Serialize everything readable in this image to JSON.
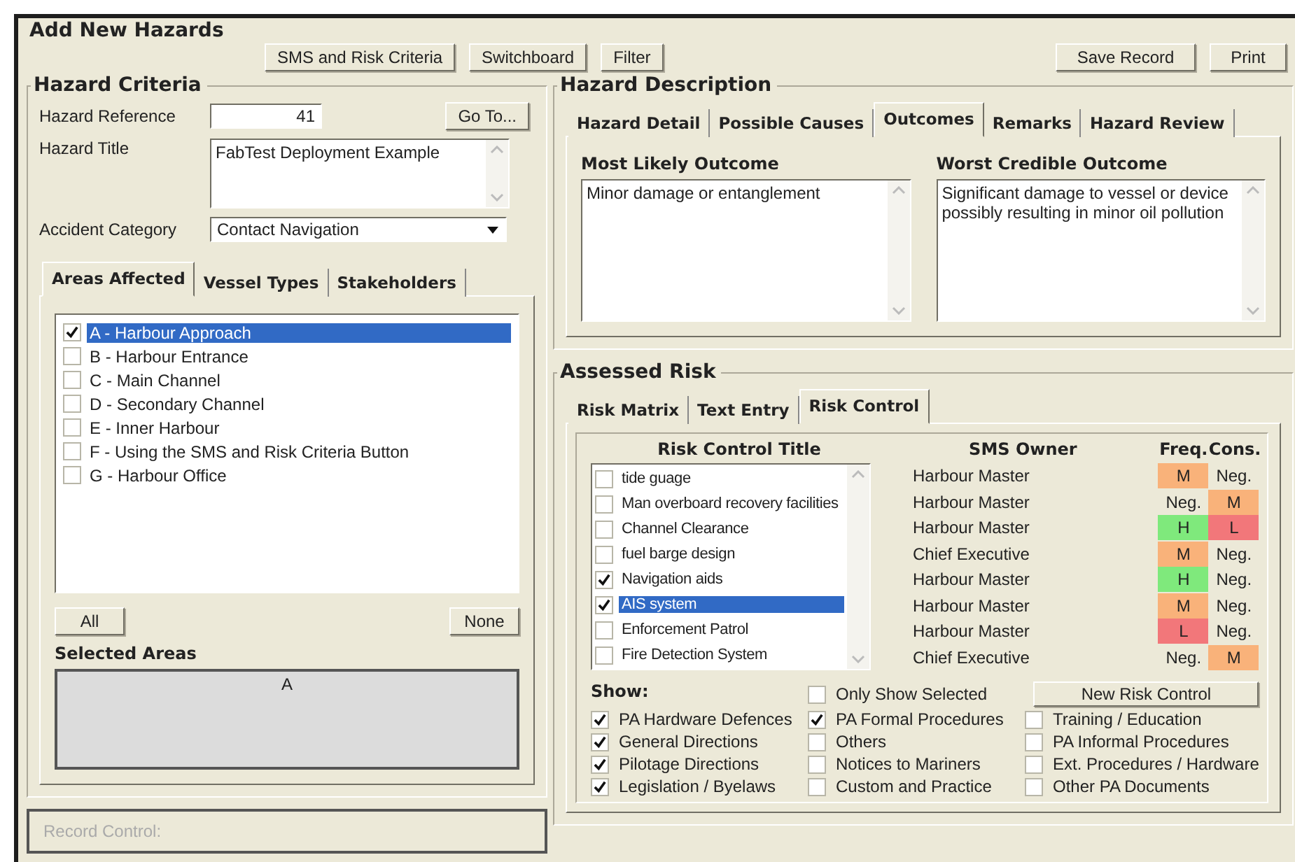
{
  "window": {
    "title": "Add New Hazards"
  },
  "toolbar": {
    "left_buttons": [
      "SMS and Risk Criteria",
      "Switchboard",
      "Filter"
    ],
    "right_buttons": [
      "Save Record",
      "Print"
    ]
  },
  "hazard_criteria": {
    "title": "Hazard Criteria",
    "reference": {
      "label": "Hazard Reference",
      "value": "41",
      "button": "Go To..."
    },
    "hazard_title": {
      "label": "Hazard Title",
      "value": "FabTest Deployment Example"
    },
    "category": {
      "label": "Accident Category",
      "value": "Contact Navigation"
    },
    "tabs": [
      {
        "label": "Areas Affected",
        "selected": true
      },
      {
        "label": "Vessel Types",
        "selected": false
      },
      {
        "label": "Stakeholders",
        "selected": false
      }
    ],
    "areas": [
      {
        "label": "A - Harbour Approach",
        "checked": true,
        "selected": true
      },
      {
        "label": "B - Harbour Entrance",
        "checked": false,
        "selected": false
      },
      {
        "label": "C - Main Channel",
        "checked": false,
        "selected": false
      },
      {
        "label": "D - Secondary Channel",
        "checked": false,
        "selected": false
      },
      {
        "label": "E - Inner Harbour",
        "checked": false,
        "selected": false
      },
      {
        "label": "F - Using the SMS and Risk Criteria Button",
        "checked": false,
        "selected": false
      },
      {
        "label": "G - Harbour Office",
        "checked": false,
        "selected": false
      }
    ],
    "buttons": [
      "All",
      "None"
    ],
    "selected_areas": {
      "label": "Selected Areas",
      "value": "A"
    }
  },
  "record_control": {
    "label": "Record Control:"
  },
  "hazard_description": {
    "title": "Hazard Description",
    "tabs": [
      {
        "label": "Hazard Detail",
        "selected": false
      },
      {
        "label": "Possible Causes",
        "selected": false
      },
      {
        "label": "Outcomes",
        "selected": true
      },
      {
        "label": "Remarks",
        "selected": false
      },
      {
        "label": "Hazard Review",
        "selected": false
      }
    ],
    "outcomes": [
      {
        "label": "Most Likely Outcome",
        "text": "Minor damage or entanglement"
      },
      {
        "label": "Worst Credible Outcome",
        "text": "Significant damage to vessel or device possibly resulting in minor oil pollution"
      }
    ]
  },
  "assessed_risk": {
    "title": "Assessed Risk",
    "tabs": [
      {
        "label": "Risk Matrix",
        "selected": false
      },
      {
        "label": "Text Entry",
        "selected": false
      },
      {
        "label": "Risk Control",
        "selected": true
      }
    ],
    "columns": [
      "Risk Control Title",
      "SMS Owner",
      "Freq.",
      "Cons."
    ],
    "controls": [
      {
        "title": "tide guage",
        "checked": false,
        "selected": false,
        "owner": "Harbour Master",
        "freq": {
          "text": "M",
          "color": "#f9b27a"
        },
        "cons": {
          "text": "Neg."
        }
      },
      {
        "title": "Man overboard recovery facilities",
        "checked": false,
        "selected": false,
        "owner": "Harbour Master",
        "freq": {
          "text": "Neg."
        },
        "cons": {
          "text": "M",
          "color": "#f9b27a"
        }
      },
      {
        "title": "Channel Clearance",
        "checked": false,
        "selected": false,
        "owner": "Harbour Master",
        "freq": {
          "text": "H",
          "color": "#7fe97c"
        },
        "cons": {
          "text": "L",
          "color": "#f2777a"
        }
      },
      {
        "title": "fuel barge design",
        "checked": false,
        "selected": false,
        "owner": "Chief Executive",
        "freq": {
          "text": "M",
          "color": "#f9b27a"
        },
        "cons": {
          "text": "Neg."
        }
      },
      {
        "title": "Navigation aids",
        "checked": true,
        "selected": false,
        "owner": "Harbour Master",
        "freq": {
          "text": "H",
          "color": "#7fe97c"
        },
        "cons": {
          "text": "Neg."
        }
      },
      {
        "title": "AIS system",
        "checked": true,
        "selected": true,
        "owner": "Harbour Master",
        "freq": {
          "text": "M",
          "color": "#f9b27a"
        },
        "cons": {
          "text": "Neg."
        }
      },
      {
        "title": "Enforcement Patrol",
        "checked": false,
        "selected": false,
        "owner": "Harbour Master",
        "freq": {
          "text": "L",
          "color": "#f2777a"
        },
        "cons": {
          "text": "Neg."
        }
      },
      {
        "title": "Fire Detection System",
        "checked": false,
        "selected": false,
        "owner": "Chief Executive",
        "freq": {
          "text": "Neg."
        },
        "cons": {
          "text": "M",
          "color": "#f9b27a"
        }
      }
    ],
    "show_label": "Show:",
    "only_selected": {
      "label": "Only Show Selected",
      "checked": false
    },
    "new_button": "New Risk Control",
    "filters": [
      {
        "label": "PA Hardware Defences",
        "checked": true
      },
      {
        "label": "General Directions",
        "checked": true
      },
      {
        "label": "Pilotage Directions",
        "checked": true
      },
      {
        "label": "Legislation / Byelaws",
        "checked": true
      },
      {
        "label": "PA Formal Procedures",
        "checked": true
      },
      {
        "label": "Others",
        "checked": false
      },
      {
        "label": "Notices to Mariners",
        "checked": false
      },
      {
        "label": "Custom and Practice",
        "checked": false
      },
      {
        "label": "Training / Education",
        "checked": false
      },
      {
        "label": "PA Informal Procedures",
        "checked": false
      },
      {
        "label": "Ext. Procedures / Hardware",
        "checked": false
      },
      {
        "label": "Other PA Documents",
        "checked": false
      }
    ]
  }
}
